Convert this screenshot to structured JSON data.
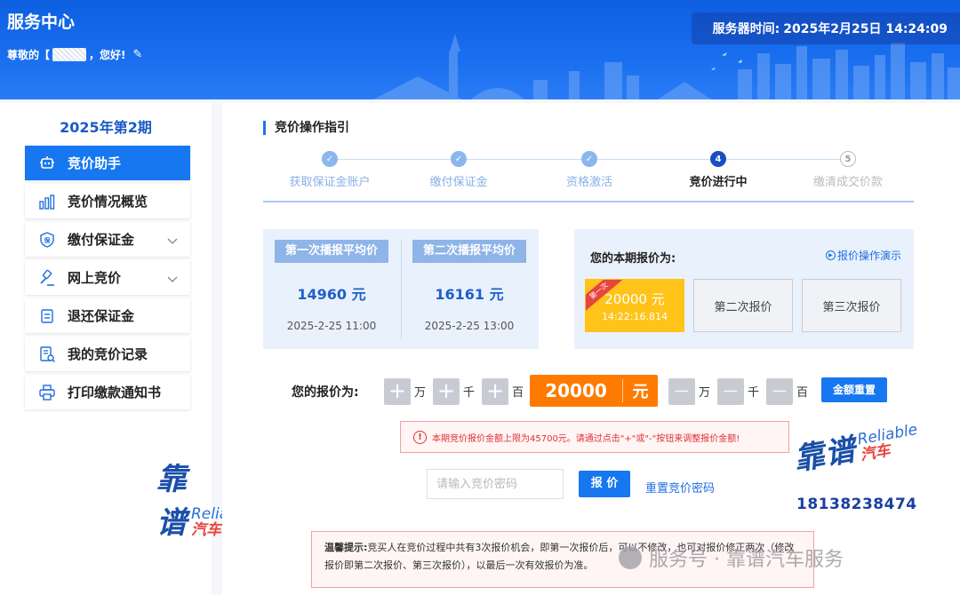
{
  "header": {
    "title": "服务中心",
    "greeting_prefix": "尊敬的【",
    "greeting_suffix": "，您好!",
    "server_time_label": "服务器时间:",
    "server_time_value": "2025年2月25日 14:24:09"
  },
  "sidebar": {
    "period": "2025年第2期",
    "items": [
      {
        "label": "竞价助手",
        "icon": "robot-icon",
        "active": true
      },
      {
        "label": "竞价情况概览",
        "icon": "bar-chart-icon"
      },
      {
        "label": "缴付保证金",
        "icon": "shield-icon",
        "expandable": true
      },
      {
        "label": "网上竞价",
        "icon": "gavel-icon",
        "expandable": true
      },
      {
        "label": "退还保证金",
        "icon": "refund-icon"
      },
      {
        "label": "我的竞价记录",
        "icon": "record-icon"
      },
      {
        "label": "打印缴款通知书",
        "icon": "printer-icon"
      }
    ]
  },
  "guide": {
    "title": "竞价操作指引",
    "steps": [
      {
        "label": "获取保证金账户",
        "state": "done"
      },
      {
        "label": "缴付保证金",
        "state": "done"
      },
      {
        "label": "资格激活",
        "state": "done"
      },
      {
        "label": "竞价进行中",
        "state": "current",
        "num": "4"
      },
      {
        "label": "缴清成交价款",
        "state": "todo",
        "num": "5"
      }
    ]
  },
  "averages": [
    {
      "label": "第一次播报平均价",
      "price": "14960 元",
      "time": "2025-2-25 11:00"
    },
    {
      "label": "第二次播报平均价",
      "price": "16161 元",
      "time": "2025-2-25 13:00"
    }
  ],
  "my_bids": {
    "label": "您的本期报价为:",
    "demo_link": "报价操作演示",
    "first_tag": "第一次",
    "first_amount": "20000 元",
    "first_time": "14:22:16.814",
    "second": "第二次报价",
    "third": "第三次报价"
  },
  "bid_input": {
    "label": "您的报价为:",
    "plus": "+",
    "minus": "—",
    "unit_wan": "万",
    "unit_qian": "千",
    "unit_bai": "百",
    "value": "20000",
    "currency": "元",
    "reset_amount": "金额重置",
    "warning": "本期竞价报价金额上限为45700元。请通过点击\"+\"或\"-\"按钮来调整报价金额!"
  },
  "password": {
    "placeholder": "请输入竞价密码",
    "submit": "报 价",
    "reset": "重置竞价密码"
  },
  "tip": {
    "label": "温馨提示:",
    "text": "竞买人在竞价过程中共有3次报价机会，即第一次报价后，可以不修改，也可对报价修正两次（修改报价即第二次报价、第三次报价），以最后一次有效报价为准。"
  },
  "watermarks": {
    "brand_cn": "靠谱",
    "brand_en": "Reliable",
    "brand_cn2": "汽车",
    "phone": "18138238474",
    "service": "服务号 · 靠谱汽车服务"
  },
  "colors": {
    "primary": "#1677f0",
    "header": "#0d5fe0",
    "price": "#ff7a00",
    "bid_first": "#ffc31a",
    "warning": "#e03131"
  }
}
